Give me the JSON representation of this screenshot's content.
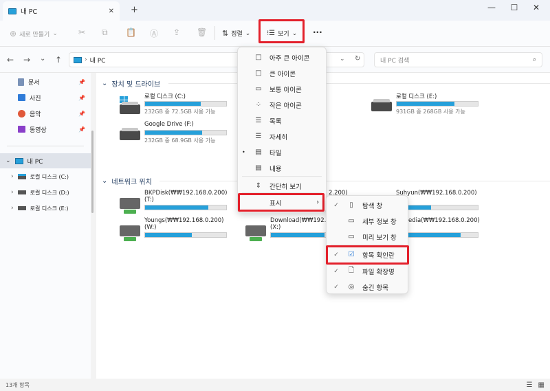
{
  "window": {
    "tab_title": "내 PC",
    "tab_close": "✕",
    "new_tab": "+"
  },
  "toolbar": {
    "new_label": "새로 만들기",
    "sort_label": "정렬",
    "view_label": "보기",
    "more_label": "···"
  },
  "address": {
    "path_label": "내 PC",
    "search_placeholder": "내 PC 검색"
  },
  "sidebar": {
    "quick": [
      {
        "label": "문서",
        "icon": "document-icon"
      },
      {
        "label": "사진",
        "icon": "pictures-icon"
      },
      {
        "label": "음악",
        "icon": "music-icon"
      },
      {
        "label": "동영상",
        "icon": "video-icon"
      }
    ],
    "this_pc": "내 PC",
    "drives": [
      "로컬 디스크 (C:)",
      "로컬 디스크 (D:)",
      "로컬 디스크 (E:)"
    ]
  },
  "sections": {
    "devices": "장치 및 드라이브",
    "network": "네트워크 위치"
  },
  "drives": [
    {
      "name": "로컬 디스크 (C:)",
      "size": "232GB 중 72.5GB 사용 가능",
      "used_fraction": 0.69
    },
    {
      "name": "로컬 디스크 (E:)",
      "size": "931GB 중 268GB 사용 가능",
      "used_fraction": 0.71
    },
    {
      "name": "Google Drive (F:)",
      "size": "232GB 중 68.9GB 사용 가능",
      "used_fraction": 0.7
    }
  ],
  "network": [
    {
      "name": "BKPDisk(₩₩192.168.0.200)",
      "letter": "(T:)",
      "used_fraction": 0.78
    },
    {
      "name": "Suhyun(₩₩192.168.0.200)",
      "letter": "",
      "used_fraction": 0.42
    },
    {
      "name": "Youngs(₩₩192.168.0.200)",
      "letter": "(W:)",
      "used_fraction": 0.58
    },
    {
      "name": "Download(₩₩192.16",
      "letter": "(X:)",
      "used_fraction": 0.66
    },
    {
      "name": "timedia(₩₩192.168.0.200)",
      "letter": "",
      "used_fraction": 0.78
    },
    {
      "name": "2.200)",
      "letter": "",
      "used_fraction": 0.0
    }
  ],
  "view_menu": [
    {
      "label": "아주 큰 아이콘",
      "icon": "□"
    },
    {
      "label": "큰 아이콘",
      "icon": "□"
    },
    {
      "label": "보통 아이콘",
      "icon": "▭"
    },
    {
      "label": "작은 아이콘",
      "icon": "⁘"
    },
    {
      "label": "목록",
      "icon": "☰"
    },
    {
      "label": "자세히",
      "icon": "☰"
    },
    {
      "label": "타일",
      "icon": "▤",
      "selected": true
    },
    {
      "label": "내용",
      "icon": "▤"
    },
    {
      "label": "간단히 보기",
      "icon": "⇕"
    },
    {
      "label": "표시",
      "icon": "",
      "chevron": "›"
    }
  ],
  "show_menu": [
    {
      "label": "탐색 창",
      "checked": true
    },
    {
      "label": "세부 정보 창",
      "checked": false
    },
    {
      "label": "미리 보기 창",
      "checked": false
    },
    {
      "label": "항목 확인란",
      "checked": true
    },
    {
      "label": "파일 확장명",
      "checked": true
    },
    {
      "label": "숨긴 항목",
      "checked": true
    }
  ],
  "status": {
    "count": "13개 항목"
  },
  "colors": {
    "highlight": "#e3202b",
    "bar": "#26a0da"
  }
}
